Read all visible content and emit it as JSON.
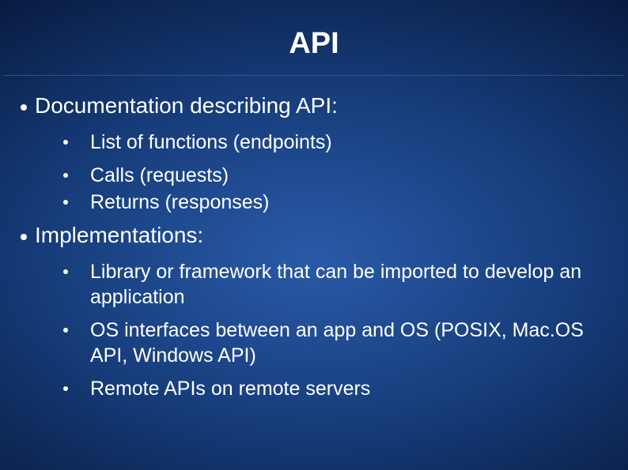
{
  "title": "API",
  "sections": [
    {
      "heading": "Documentation describing API:",
      "groups": [
        [
          "List of functions (endpoints)"
        ],
        [
          "Calls (requests)",
          "Returns (responses)"
        ]
      ]
    },
    {
      "heading": "Implementations:",
      "groups": [
        [
          "Library or framework that can be imported to develop an application"
        ],
        [
          "OS interfaces between an app and OS (POSIX, Mac.OS API, Windows API)"
        ],
        [
          "Remote APIs on remote servers"
        ]
      ]
    }
  ]
}
